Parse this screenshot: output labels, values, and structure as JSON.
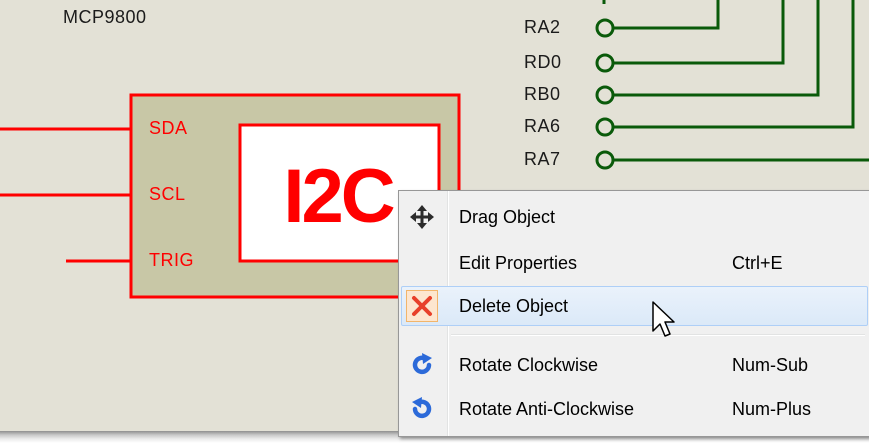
{
  "schematic": {
    "chip_name": "MCP9800",
    "chip_label": "I2C",
    "pins": [
      "SDA",
      "SCL",
      "TRIG"
    ],
    "port_labels": [
      "RA2",
      "RD0",
      "RB0",
      "RA6",
      "RA7"
    ],
    "colors": {
      "background": "#e3e1d6",
      "component_border": "#ff0000",
      "component_fill": "#c8c7a6",
      "wire_green": "#0a5a0a"
    }
  },
  "context_menu": {
    "items": [
      {
        "label": "Drag Object",
        "shortcut": "",
        "icon": "move-arrows-icon"
      },
      {
        "label": "Edit Properties",
        "shortcut": "Ctrl+E",
        "icon": ""
      },
      {
        "label": "Delete Object",
        "shortcut": "",
        "icon": "delete-x-icon",
        "highlighted": true
      },
      {
        "label": "Rotate Clockwise",
        "shortcut": "Num-Sub",
        "icon": "rotate-clockwise-icon"
      },
      {
        "label": "Rotate Anti-Clockwise",
        "shortcut": "Num-Plus",
        "icon": "rotate-anticlockwise-icon"
      }
    ]
  }
}
